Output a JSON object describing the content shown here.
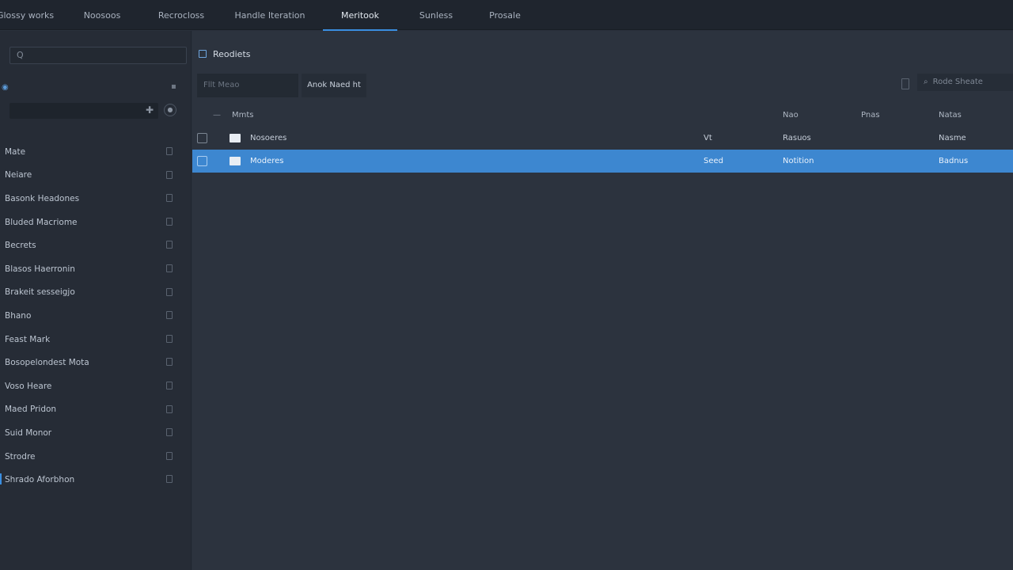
{
  "top_tabs": [
    {
      "label": "Glossy works",
      "active": false
    },
    {
      "label": "Noosoos",
      "active": false
    },
    {
      "label": "Recrocloss",
      "active": false
    },
    {
      "label": "Handle Iteration",
      "active": false
    },
    {
      "label": "Meritook",
      "active": true
    },
    {
      "label": "Sunless",
      "active": false
    },
    {
      "label": "Prosale",
      "active": false
    }
  ],
  "sidebar": {
    "search_placeholder": "Q",
    "section_icon": "◉",
    "items": [
      {
        "label": "Mate"
      },
      {
        "label": "Neiare"
      },
      {
        "label": "Basonk Headones"
      },
      {
        "label": "Bluded Macriome"
      },
      {
        "label": "Becrets"
      },
      {
        "label": "Blasos Haerronin"
      },
      {
        "label": "Brakeit sesseigjo"
      },
      {
        "label": "Bhano"
      },
      {
        "label": "Feast Mark"
      },
      {
        "label": "Bosopelondest Mota"
      },
      {
        "label": "Voso Heare"
      },
      {
        "label": "Maed Pridon"
      },
      {
        "label": "Suid Monor"
      },
      {
        "label": "Strodre"
      },
      {
        "label": "Shrado Aforbhon"
      }
    ]
  },
  "main": {
    "breadcrumb": "Reodiets",
    "filter_placeholder": "Fllt Meao",
    "action_button": "Anok Naed ht",
    "right_search": "Rode Sheate",
    "table": {
      "headers": [
        "Mmts",
        "Nao",
        "Pnas",
        "Natas"
      ],
      "rows": [
        {
          "name": "Nosoeres",
          "col1": "Vt",
          "col2": "Rasuos",
          "col3": "",
          "col4": "Nasme",
          "selected": false
        },
        {
          "name": "Moderes",
          "col1": "Seed",
          "col2": "Notition",
          "col3": "",
          "col4": "Badnus",
          "selected": true
        }
      ]
    }
  },
  "colors": {
    "accent": "#3a8ee0",
    "selected_row": "#3d87d0",
    "background": "#2a313c",
    "sidebar": "#262c36",
    "topbar": "#1f252e"
  }
}
